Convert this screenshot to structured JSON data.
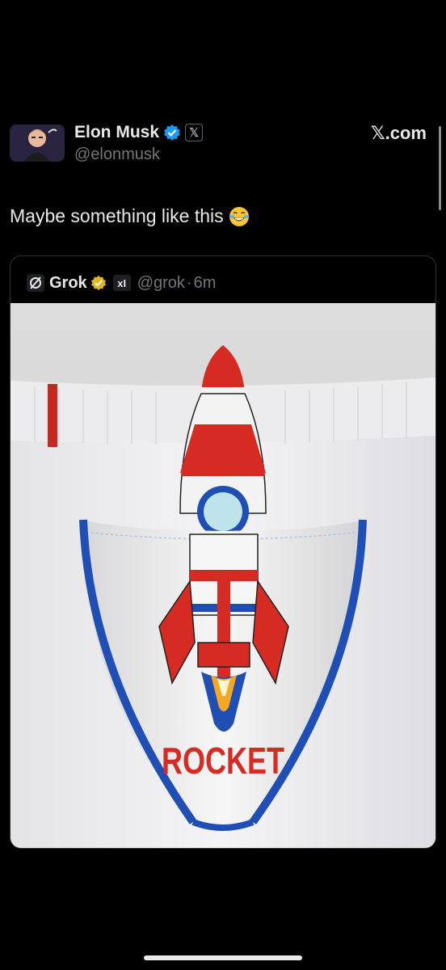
{
  "tweet": {
    "author_name": "Elon Musk",
    "author_handle": "@elonmusk",
    "badge_icon": "verified-badge-icon",
    "affiliation_icon": "x-logo-icon",
    "affiliation_glyph": "𝕏",
    "text": "Maybe something like this",
    "emoji_icon": "face-with-tears-of-joy-icon"
  },
  "brand": {
    "label": "𝕏.com"
  },
  "quote": {
    "author_name": "Grok",
    "author_handle": "@grok",
    "timestamp": "6m",
    "separator": "·",
    "logo_icon": "grok-logo-icon",
    "badge_icon": "gold-verified-badge-icon",
    "affiliation_glyph": "xI",
    "image": {
      "description_icon": "rocket-icon",
      "printed_text": "ROCKET"
    }
  },
  "colors": {
    "background": "#000000",
    "text_primary": "#e7e9ea",
    "text_secondary": "#71767b",
    "verified_blue": "#1d9bf0",
    "gold_badge": "#e2b719",
    "rocket_red": "#d62b22",
    "trim_blue": "#1f4fb5"
  }
}
